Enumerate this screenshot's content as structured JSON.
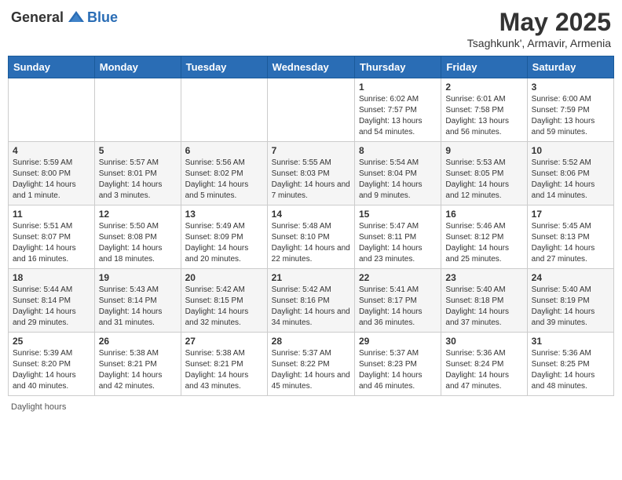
{
  "header": {
    "logo_general": "General",
    "logo_blue": "Blue",
    "month_title": "May 2025",
    "subtitle": "Tsaghkunk', Armavir, Armenia"
  },
  "weekdays": [
    "Sunday",
    "Monday",
    "Tuesday",
    "Wednesday",
    "Thursday",
    "Friday",
    "Saturday"
  ],
  "weeks": [
    [
      {
        "day": "",
        "info": ""
      },
      {
        "day": "",
        "info": ""
      },
      {
        "day": "",
        "info": ""
      },
      {
        "day": "",
        "info": ""
      },
      {
        "day": "1",
        "info": "Sunrise: 6:02 AM\nSunset: 7:57 PM\nDaylight: 13 hours\nand 54 minutes."
      },
      {
        "day": "2",
        "info": "Sunrise: 6:01 AM\nSunset: 7:58 PM\nDaylight: 13 hours\nand 56 minutes."
      },
      {
        "day": "3",
        "info": "Sunrise: 6:00 AM\nSunset: 7:59 PM\nDaylight: 13 hours\nand 59 minutes."
      }
    ],
    [
      {
        "day": "4",
        "info": "Sunrise: 5:59 AM\nSunset: 8:00 PM\nDaylight: 14 hours\nand 1 minute."
      },
      {
        "day": "5",
        "info": "Sunrise: 5:57 AM\nSunset: 8:01 PM\nDaylight: 14 hours\nand 3 minutes."
      },
      {
        "day": "6",
        "info": "Sunrise: 5:56 AM\nSunset: 8:02 PM\nDaylight: 14 hours\nand 5 minutes."
      },
      {
        "day": "7",
        "info": "Sunrise: 5:55 AM\nSunset: 8:03 PM\nDaylight: 14 hours\nand 7 minutes."
      },
      {
        "day": "8",
        "info": "Sunrise: 5:54 AM\nSunset: 8:04 PM\nDaylight: 14 hours\nand 9 minutes."
      },
      {
        "day": "9",
        "info": "Sunrise: 5:53 AM\nSunset: 8:05 PM\nDaylight: 14 hours\nand 12 minutes."
      },
      {
        "day": "10",
        "info": "Sunrise: 5:52 AM\nSunset: 8:06 PM\nDaylight: 14 hours\nand 14 minutes."
      }
    ],
    [
      {
        "day": "11",
        "info": "Sunrise: 5:51 AM\nSunset: 8:07 PM\nDaylight: 14 hours\nand 16 minutes."
      },
      {
        "day": "12",
        "info": "Sunrise: 5:50 AM\nSunset: 8:08 PM\nDaylight: 14 hours\nand 18 minutes."
      },
      {
        "day": "13",
        "info": "Sunrise: 5:49 AM\nSunset: 8:09 PM\nDaylight: 14 hours\nand 20 minutes."
      },
      {
        "day": "14",
        "info": "Sunrise: 5:48 AM\nSunset: 8:10 PM\nDaylight: 14 hours\nand 22 minutes."
      },
      {
        "day": "15",
        "info": "Sunrise: 5:47 AM\nSunset: 8:11 PM\nDaylight: 14 hours\nand 23 minutes."
      },
      {
        "day": "16",
        "info": "Sunrise: 5:46 AM\nSunset: 8:12 PM\nDaylight: 14 hours\nand 25 minutes."
      },
      {
        "day": "17",
        "info": "Sunrise: 5:45 AM\nSunset: 8:13 PM\nDaylight: 14 hours\nand 27 minutes."
      }
    ],
    [
      {
        "day": "18",
        "info": "Sunrise: 5:44 AM\nSunset: 8:14 PM\nDaylight: 14 hours\nand 29 minutes."
      },
      {
        "day": "19",
        "info": "Sunrise: 5:43 AM\nSunset: 8:14 PM\nDaylight: 14 hours\nand 31 minutes."
      },
      {
        "day": "20",
        "info": "Sunrise: 5:42 AM\nSunset: 8:15 PM\nDaylight: 14 hours\nand 32 minutes."
      },
      {
        "day": "21",
        "info": "Sunrise: 5:42 AM\nSunset: 8:16 PM\nDaylight: 14 hours\nand 34 minutes."
      },
      {
        "day": "22",
        "info": "Sunrise: 5:41 AM\nSunset: 8:17 PM\nDaylight: 14 hours\nand 36 minutes."
      },
      {
        "day": "23",
        "info": "Sunrise: 5:40 AM\nSunset: 8:18 PM\nDaylight: 14 hours\nand 37 minutes."
      },
      {
        "day": "24",
        "info": "Sunrise: 5:40 AM\nSunset: 8:19 PM\nDaylight: 14 hours\nand 39 minutes."
      }
    ],
    [
      {
        "day": "25",
        "info": "Sunrise: 5:39 AM\nSunset: 8:20 PM\nDaylight: 14 hours\nand 40 minutes."
      },
      {
        "day": "26",
        "info": "Sunrise: 5:38 AM\nSunset: 8:21 PM\nDaylight: 14 hours\nand 42 minutes."
      },
      {
        "day": "27",
        "info": "Sunrise: 5:38 AM\nSunset: 8:21 PM\nDaylight: 14 hours\nand 43 minutes."
      },
      {
        "day": "28",
        "info": "Sunrise: 5:37 AM\nSunset: 8:22 PM\nDaylight: 14 hours\nand 45 minutes."
      },
      {
        "day": "29",
        "info": "Sunrise: 5:37 AM\nSunset: 8:23 PM\nDaylight: 14 hours\nand 46 minutes."
      },
      {
        "day": "30",
        "info": "Sunrise: 5:36 AM\nSunset: 8:24 PM\nDaylight: 14 hours\nand 47 minutes."
      },
      {
        "day": "31",
        "info": "Sunrise: 5:36 AM\nSunset: 8:25 PM\nDaylight: 14 hours\nand 48 minutes."
      }
    ]
  ],
  "footer": {
    "daylight_label": "Daylight hours"
  }
}
